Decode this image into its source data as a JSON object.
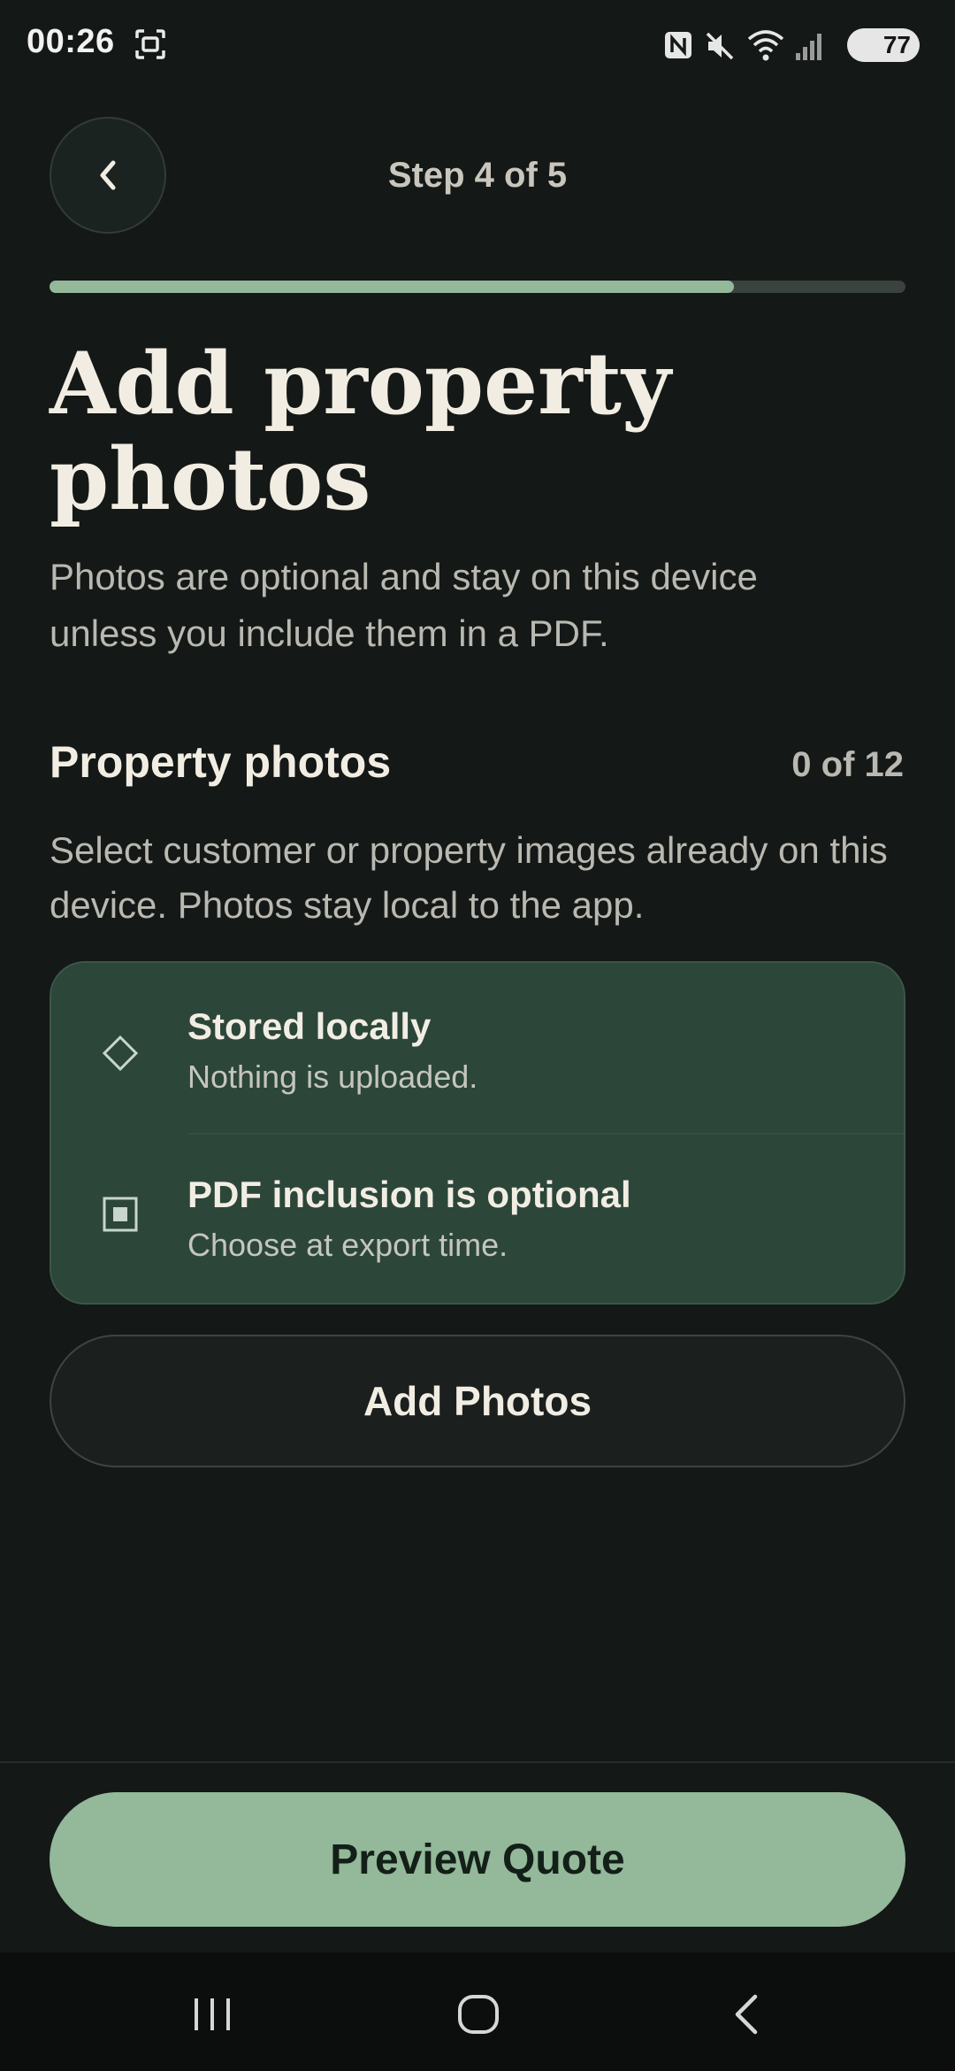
{
  "status_bar": {
    "time": "00:26",
    "battery": "77",
    "icons": [
      "screenshot-icon",
      "nfc-icon",
      "mute-icon",
      "wifi-icon",
      "signal-icon",
      "battery-icon"
    ]
  },
  "header": {
    "back_icon": "chevron-left-icon",
    "step_label": "Step 4 of 5"
  },
  "progress": {
    "value": 0.8
  },
  "page": {
    "title_line1": "Add property",
    "title_line2": "photos",
    "subtitle": "Photos are optional and stay on this device unless you include them in a PDF."
  },
  "section": {
    "title": "Property photos",
    "count": "0 of 12",
    "description": "Select customer or property images already on this device. Photos stay local to the app."
  },
  "info_card": {
    "items": [
      {
        "icon": "diamond-icon",
        "title": "Stored locally",
        "subtitle": "Nothing is uploaded."
      },
      {
        "icon": "square-check-icon",
        "title": "PDF inclusion is optional",
        "subtitle": "Choose at export time."
      }
    ]
  },
  "buttons": {
    "add_photos": "Add Photos",
    "preview_quote": "Preview Quote"
  },
  "nav_bar": {
    "icons": [
      "recents-icon",
      "home-icon",
      "back-icon"
    ]
  },
  "colors": {
    "background": "#141816",
    "accent": "#93b89a",
    "card": "#2c463a"
  }
}
